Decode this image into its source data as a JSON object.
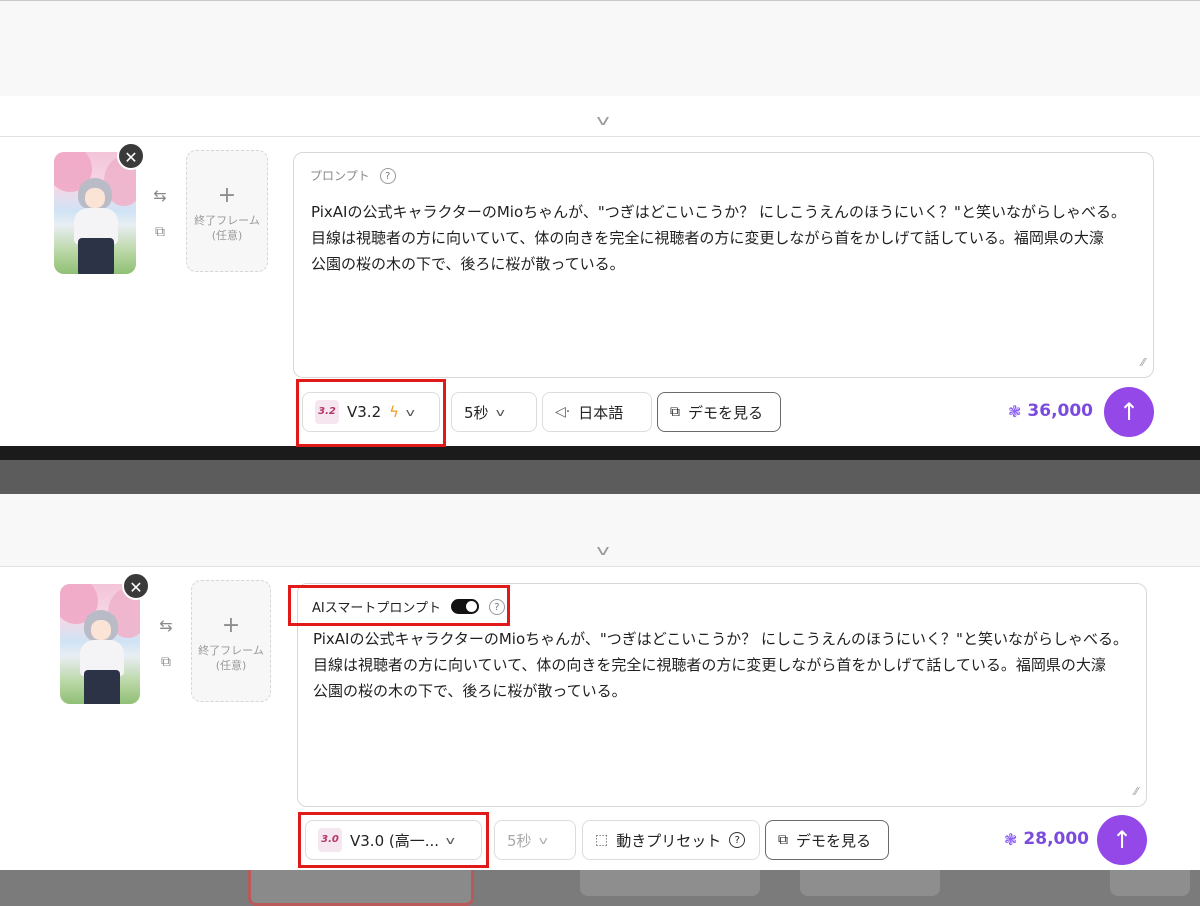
{
  "panel_top": {
    "collapse_icon": "chevron-down-icon",
    "end_frame": {
      "plus": "+",
      "line1": "終了フレーム",
      "line2": "(任意)"
    },
    "prompt_label": "プロンプト",
    "prompt_text": "PixAIの公式キャラクターのMioちゃんが、\"つぎはどこいこうか？ にしこうえんのほうにいく？\"と笑いながらしゃべる。\n目線は視聴者の方に向いていて、体の向きを完全に視聴者の方に変更しながら首をかしげて話している。福岡県の大濠\n公園の桜の木の下で、後ろに桜が散っている。",
    "model": {
      "logo": "3.2",
      "label": "V3.2"
    },
    "duration": "5秒",
    "language": "日本語",
    "demo": "デモを見る",
    "credits": "36,000"
  },
  "panel_bottom": {
    "collapse_icon": "chevron-down-icon",
    "end_frame": {
      "plus": "+",
      "line1": "終了フレーム",
      "line2": "(任意)"
    },
    "smart_prompt_label": "AIスマートプロンプト",
    "smart_prompt_enabled": true,
    "prompt_text": "PixAIの公式キャラクターのMioちゃんが、\"つぎはどこいこうか？ にしこうえんのほうにいく？\"と笑いながらしゃべる。\n目線は視聴者の方に向いていて、体の向きを完全に視聴者の方に変更しながら首をかしげて話している。福岡県の大濠\n公園の桜の木の下で、後ろに桜が散っている。",
    "model": {
      "logo": "3.0",
      "label": "V3.0 (高一..."
    },
    "duration": "5秒",
    "motion_preset": "動きプリセット",
    "demo": "デモを見る",
    "credits": "28,000"
  },
  "colors": {
    "accent": "#9448e8",
    "highlight": "#e01919",
    "credits_text": "#7b4be0"
  }
}
